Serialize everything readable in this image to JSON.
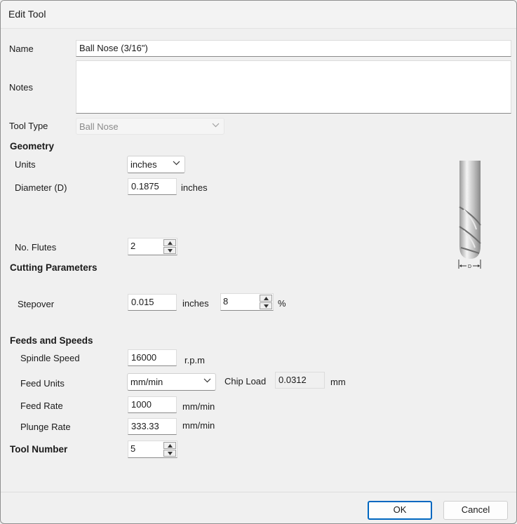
{
  "window": {
    "title": "Edit Tool"
  },
  "form": {
    "name_label": "Name",
    "name_value": "Ball Nose (3/16\")",
    "notes_label": "Notes",
    "notes_value": "",
    "tool_type_label": "Tool Type",
    "tool_type_value": "Ball Nose"
  },
  "geometry": {
    "heading": "Geometry",
    "units_label": "Units",
    "units_value": "inches",
    "diameter_label": "Diameter (D)",
    "diameter_value": "0.1875",
    "diameter_unit": "inches",
    "flutes_label": "No. Flutes",
    "flutes_value": "2",
    "diagram_dim_label": "D"
  },
  "cutting": {
    "heading": "Cutting Parameters",
    "stepover_label": "Stepover",
    "stepover_value": "0.015",
    "stepover_unit": "inches",
    "stepover_percent_value": "8",
    "percent_symbol": "%"
  },
  "feeds": {
    "heading": "Feeds and Speeds",
    "spindle_label": "Spindle Speed",
    "spindle_value": "16000",
    "spindle_unit": "r.p.m",
    "feed_units_label": "Feed Units",
    "feed_units_value": "mm/min",
    "chip_load_label": "Chip Load",
    "chip_load_value": "0.0312",
    "chip_load_unit": "mm",
    "feed_rate_label": "Feed Rate",
    "feed_rate_value": "1000",
    "feed_rate_unit": "mm/min",
    "plunge_label": "Plunge Rate",
    "plunge_value": "333.33",
    "plunge_unit": "mm/min"
  },
  "tool_number": {
    "heading": "Tool Number",
    "value": "5"
  },
  "buttons": {
    "ok": "OK",
    "cancel": "Cancel"
  }
}
